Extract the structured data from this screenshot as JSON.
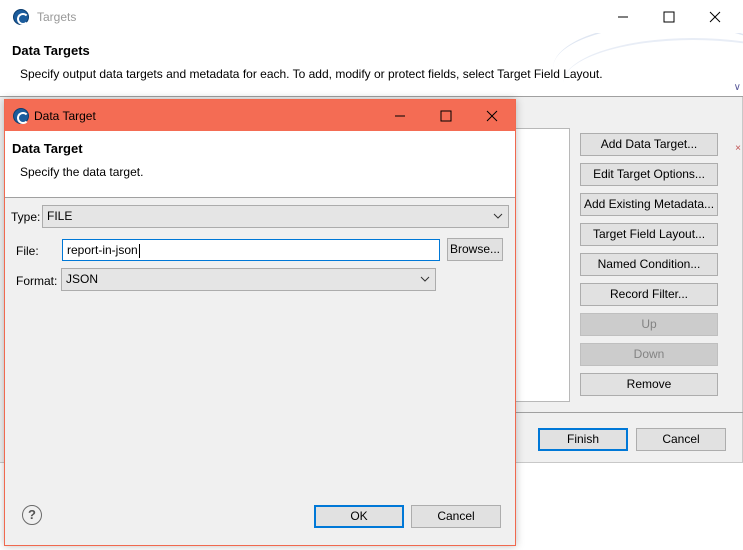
{
  "targets_window": {
    "title": "Targets",
    "header_title": "Data Targets",
    "header_desc": "Specify output data targets and metadata for each. To add, modify or protect fields, select Target Field Layout.",
    "side_buttons": [
      {
        "label": "Add Data Target...",
        "enabled": true
      },
      {
        "label": "Edit Target Options...",
        "enabled": true
      },
      {
        "label": "Add Existing Metadata...",
        "enabled": true
      },
      {
        "label": "Target Field Layout...",
        "enabled": true
      },
      {
        "label": "Named Condition...",
        "enabled": true
      },
      {
        "label": "Record Filter...",
        "enabled": true
      },
      {
        "label": "Up",
        "enabled": false
      },
      {
        "label": "Down",
        "enabled": false
      },
      {
        "label": "Remove",
        "enabled": true
      }
    ],
    "finish_label": "Finish",
    "cancel_label": "Cancel"
  },
  "data_target_dialog": {
    "title": "Data Target",
    "header_title": "Data Target",
    "header_desc": "Specify the data target.",
    "type_label": "Type:",
    "type_value": "FILE",
    "file_label": "File:",
    "file_value": "report-in-json",
    "browse_label": "Browse...",
    "format_label": "Format:",
    "format_value": "JSON",
    "help_glyph": "?",
    "ok_label": "OK",
    "cancel_label": "Cancel"
  },
  "colors": {
    "dialog_titlebar": "#f46c54",
    "focus_accent": "#0078d7"
  },
  "icons": [
    "app-logo-icon",
    "minimize-icon",
    "maximize-icon",
    "close-icon",
    "chevron-down-icon",
    "help-icon"
  ]
}
